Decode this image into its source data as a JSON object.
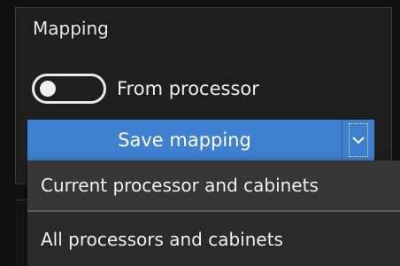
{
  "panel": {
    "title": "Mapping",
    "toggle": {
      "label": "From processor",
      "on": false
    },
    "save_button": {
      "label": "Save mapping",
      "split_icon": "chevron-down-icon",
      "color": "#3f7fd0"
    }
  },
  "dropdown_menu": {
    "items": [
      {
        "label": "Current processor and cabinets"
      },
      {
        "label": "All processors and cabinets"
      }
    ]
  }
}
